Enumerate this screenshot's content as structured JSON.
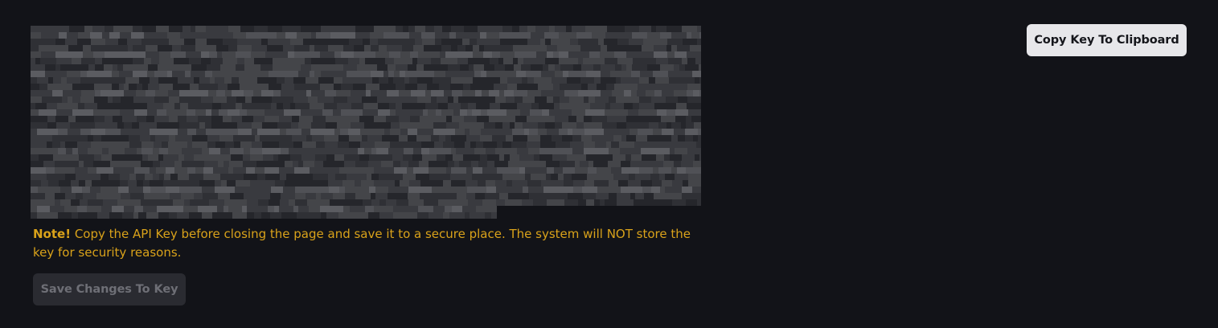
{
  "api_key": {
    "value_state": "redacted"
  },
  "note": {
    "label": "Note!",
    "text": " Copy the API Key before closing the page and save it to a secure place. The system will NOT store the key for security reasons."
  },
  "buttons": {
    "copy_label": "Copy Key To Clipboard",
    "save_label": "Save Changes To Key",
    "save_disabled": true
  },
  "colors": {
    "background": "#121318",
    "note_text": "#d9a21a",
    "copy_button_bg": "#e7e7ea",
    "save_button_bg": "#2a2b31",
    "save_button_text": "#6e6f76"
  }
}
